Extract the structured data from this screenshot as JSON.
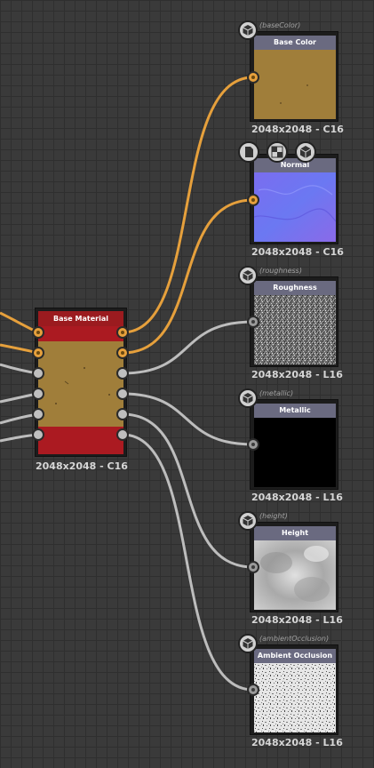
{
  "material_node": {
    "title": "Base Material",
    "resolution": "2048x2048 - C16"
  },
  "outputs": [
    {
      "id": "baseColor",
      "identifier": "(baseColor)",
      "title": "Base Color",
      "resolution": "2048x2048 - C16"
    },
    {
      "id": "normal",
      "identifier": "",
      "title": "Normal",
      "resolution": "2048x2048 - C16"
    },
    {
      "id": "roughness",
      "identifier": "(roughness)",
      "title": "Roughness",
      "resolution": "2048x2048 - L16"
    },
    {
      "id": "metallic",
      "identifier": "(metallic)",
      "title": "Metallic",
      "resolution": "2048x2048 - L16"
    },
    {
      "id": "height",
      "identifier": "(height)",
      "title": "Height",
      "resolution": "2048x2048 - L16"
    },
    {
      "id": "ambientOcclusion",
      "identifier": "(ambientOcclusion)",
      "title": "Ambient Occlusion",
      "resolution": "2048x2048 - L16"
    }
  ],
  "icons": {
    "output_badge": "cube-icon",
    "normal_toolbar": [
      "document-icon",
      "checker-icon",
      "cube-icon"
    ]
  },
  "colors": {
    "background": "#3a3a3a",
    "grid": "#2f2f2f",
    "wire_color": "#e6a03c",
    "wire_gray": "#bdbdbd",
    "material_header": "#9b1b1f",
    "output_header": "#6a6a80",
    "base_color_fill": "#a07e3a",
    "normal_fill": "#6c6cf0"
  }
}
